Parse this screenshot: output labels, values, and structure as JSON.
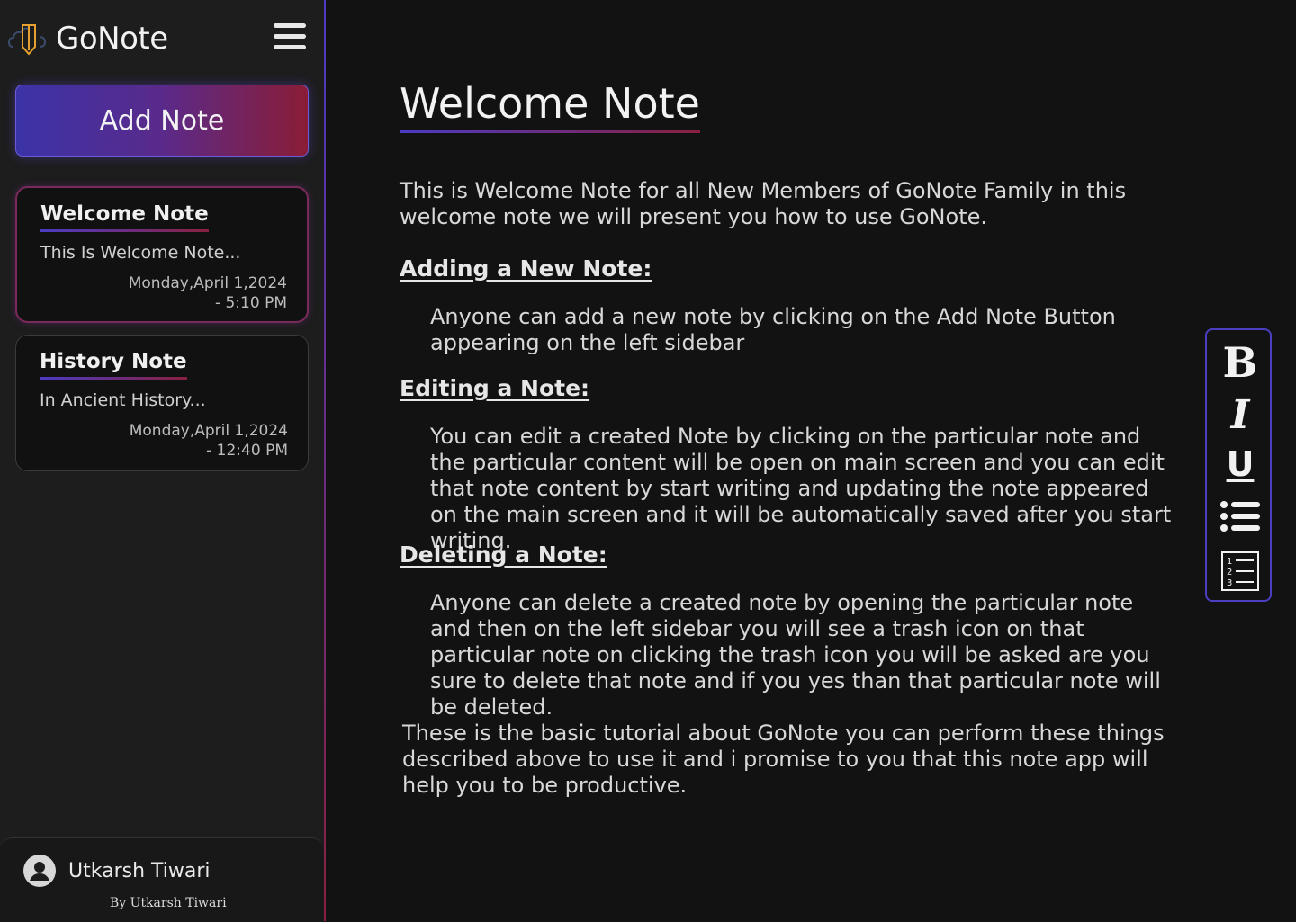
{
  "app": {
    "name": "GoNote",
    "add_note_label": "Add Note"
  },
  "notes": [
    {
      "title": "Welcome Note",
      "snippet": "This Is Welcome Note...",
      "date": "Monday,April 1,2024",
      "time": "- 5:10 PM",
      "active": true
    },
    {
      "title": "History Note",
      "snippet": "In Ancient History...",
      "date": "Monday,April 1,2024",
      "time": "- 12:40 PM",
      "active": false
    }
  ],
  "user": {
    "name": "Utkarsh Tiwari",
    "credit": "By Utkarsh Tiwari"
  },
  "document": {
    "title": "Welcome Note",
    "intro": "This is Welcome Note for all  New Members of GoNote Family in this welcome note we will present you how to use GoNote.",
    "sections": [
      {
        "heading": "Adding a New Note:",
        "body": "Anyone can add a new note by clicking on the Add Note Button appearing on the left sidebar"
      },
      {
        "heading": "Editing a Note:",
        "body": "You can edit a created Note by clicking on the particular note and the particular content will be open on main screen and you can edit that note content by start writing and updating the note appeared on the main screen and it will be automatically saved after you start writing."
      },
      {
        "heading": "Deleting a Note:",
        "body": "Anyone can delete a created note by opening the particular note and then on the left sidebar you will see a trash icon on that particular note on clicking the trash icon you will be asked are you sure to delete that note and if you yes than that particular note will be deleted."
      }
    ],
    "outro": "These is the basic tutorial about GoNote you can perform these things described above to use it and i promise to you that this note app will help you to be productive."
  },
  "toolbar": {
    "bold_label": "B",
    "italic_label": "I",
    "underline_label": "U",
    "icons": [
      "bold-icon",
      "italic-icon",
      "underline-icon",
      "bullet-list-icon",
      "numbered-list-icon"
    ]
  },
  "colors": {
    "accent_blue": "#4b3bc4",
    "accent_red": "#8a2040",
    "background": "#121212",
    "sidebar": "#1d1d1d"
  }
}
